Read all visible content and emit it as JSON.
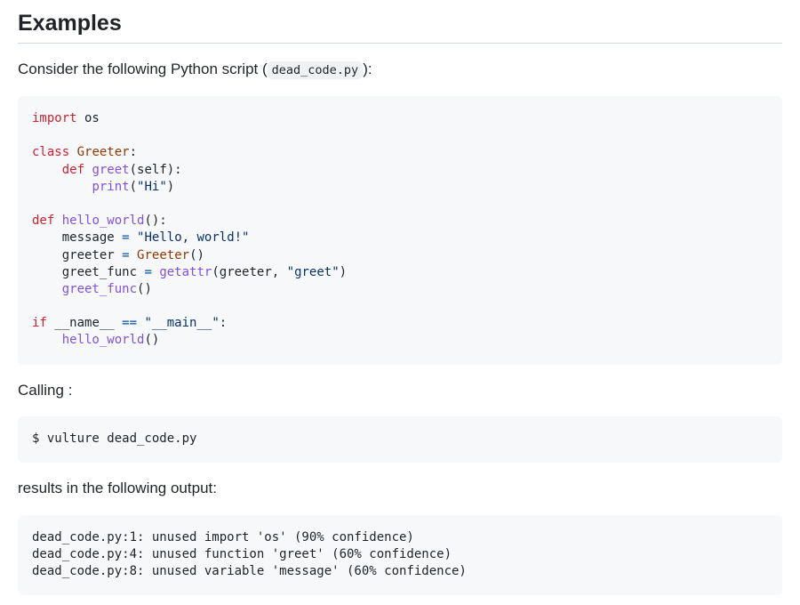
{
  "heading": "Examples",
  "intro": {
    "before": "Consider the following Python script (",
    "filename": "dead_code.py",
    "after": "):"
  },
  "script": {
    "kw_import": "import",
    "mod_os": " os",
    "kw_class": "class",
    "cls_greeter": "Greeter",
    "colon": ":",
    "kw_def": "def",
    "fn_greet": "greet",
    "greet_params": "(self):",
    "fn_print": "print",
    "print_open": "(",
    "str_hi": "\"Hi\"",
    "print_close": ")",
    "fn_hello_world": "hello_world",
    "hw_params": "():",
    "var_message": "message",
    "op_eq": "=",
    "str_hello": "\"Hello, world!\"",
    "var_greeter": "greeter",
    "call_parens": "()",
    "var_greet_func": "greet_func",
    "fn_getattr": "getattr",
    "getattr_args_a": "(greeter, ",
    "str_greet": "\"greet\"",
    "getattr_close": ")",
    "kw_if": "if",
    "dunder_name": "__name__",
    "op_eqeq": "==",
    "str_main": "\"__main__\"",
    "if_colon": ":"
  },
  "calling_label": "Calling :",
  "command": "$ vulture dead_code.py",
  "results_label": "results in the following output:",
  "output": [
    "dead_code.py:1: unused import 'os' (90% confidence)",
    "dead_code.py:4: unused function 'greet' (60% confidence)",
    "dead_code.py:8: unused variable 'message' (60% confidence)"
  ]
}
